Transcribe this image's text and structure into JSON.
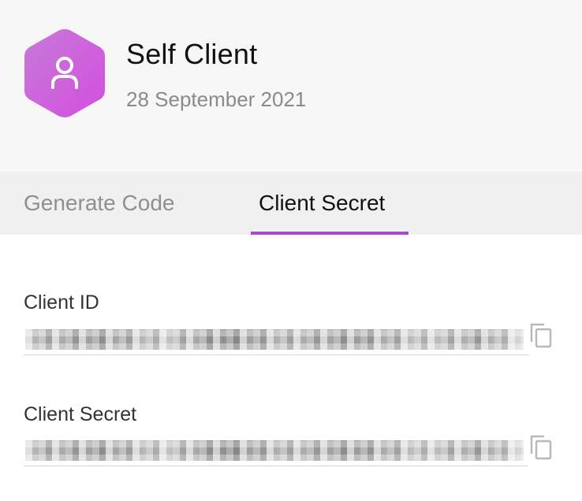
{
  "header": {
    "client_name": "Self Client",
    "created_date": "28 September 2021",
    "avatar_icon": "user-icon",
    "avatar_gradient": [
      "#c36fd6",
      "#d24fdf"
    ]
  },
  "tabs": [
    {
      "label": "Generate Code",
      "active": false
    },
    {
      "label": "Client Secret",
      "active": true
    }
  ],
  "accent_color": "#a94bc9",
  "fields": {
    "client_id": {
      "label": "Client ID",
      "value_visible": "redacted",
      "copy_icon": "copy-icon"
    },
    "client_secret": {
      "label": "Client Secret",
      "value_visible": "redacted",
      "copy_icon": "copy-icon"
    }
  }
}
